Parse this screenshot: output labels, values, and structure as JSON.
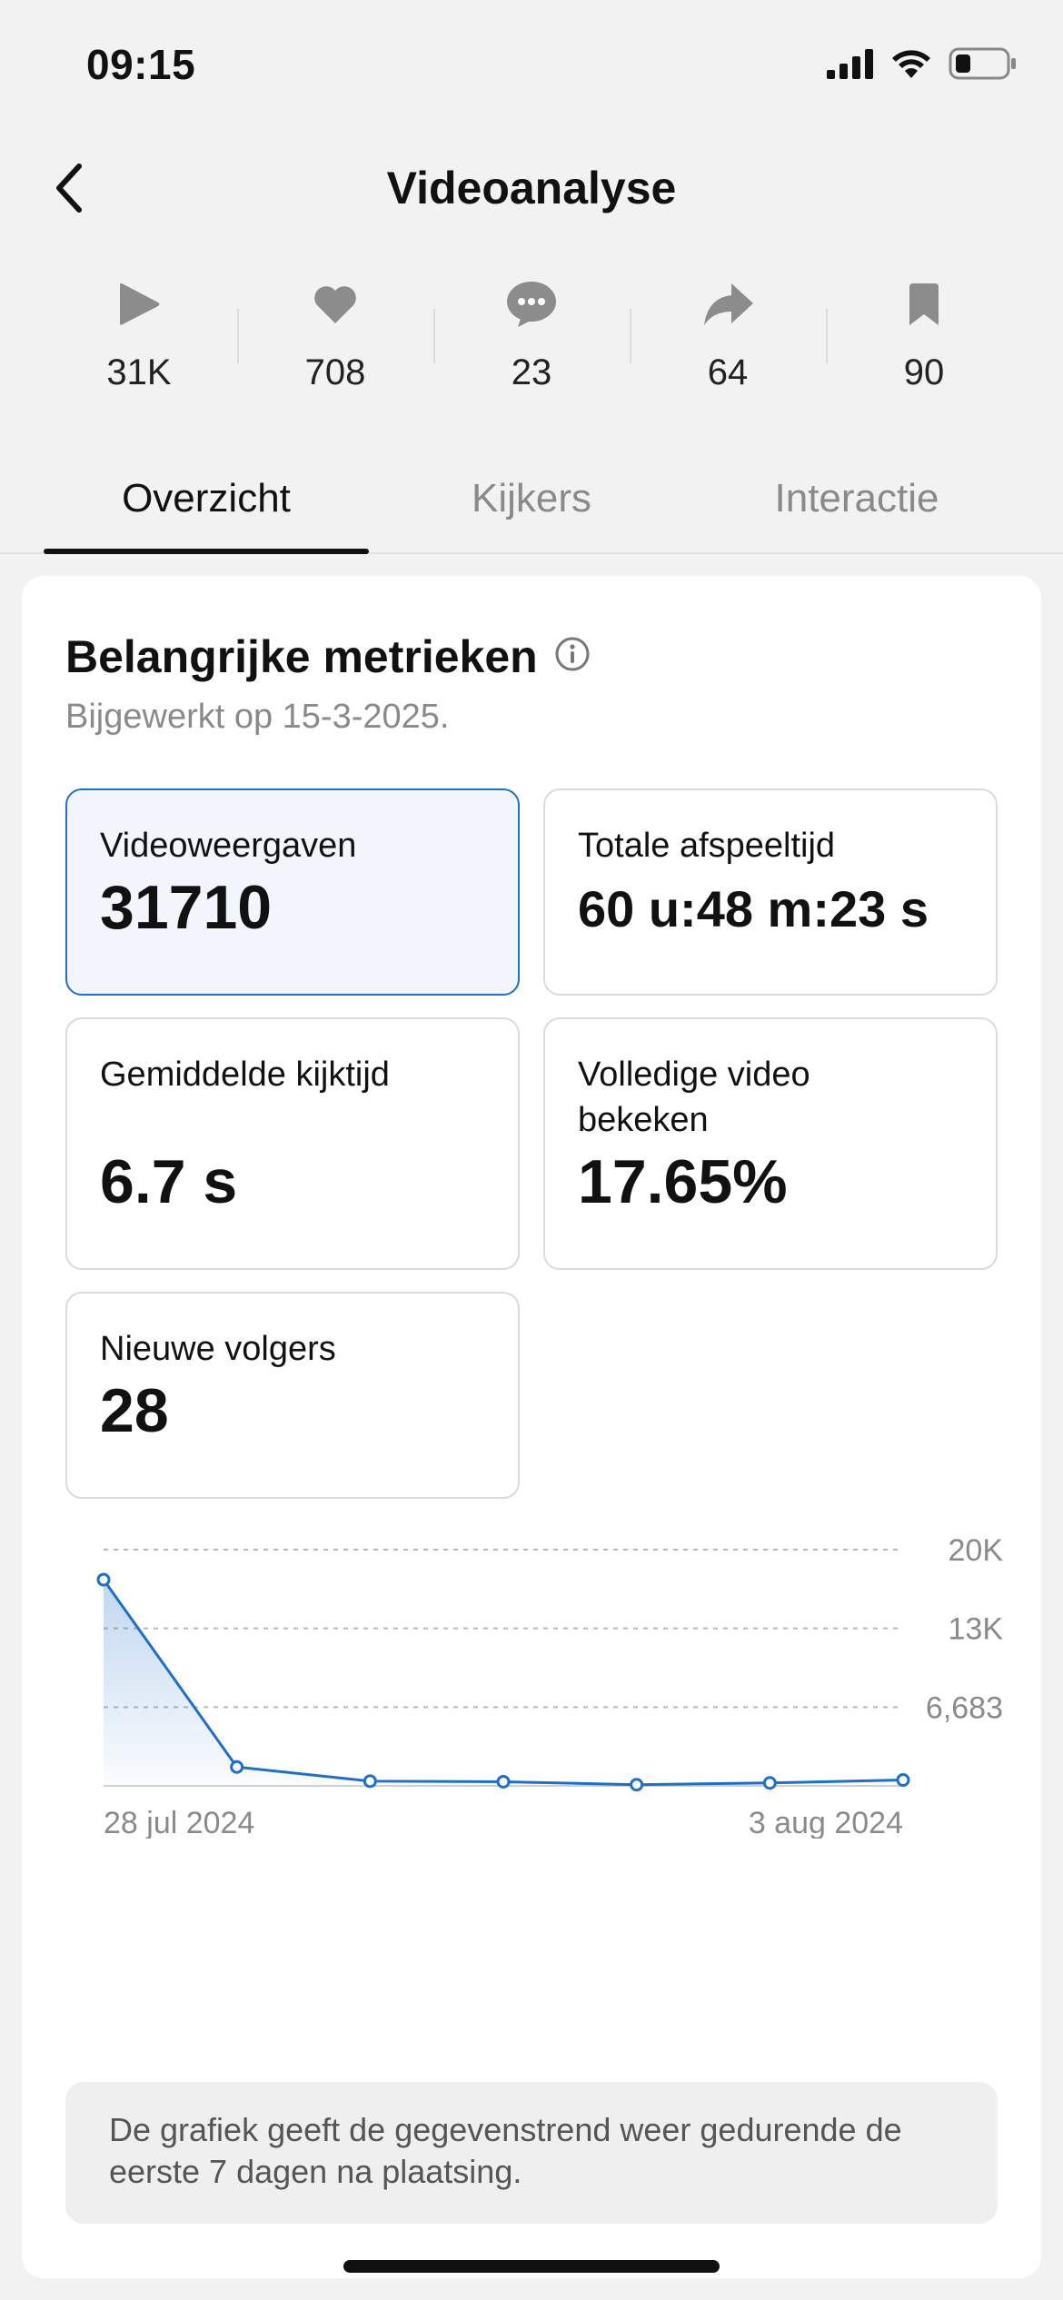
{
  "status_bar": {
    "time": "09:15"
  },
  "header": {
    "title": "Videoanalyse"
  },
  "stats": [
    {
      "icon": "play-icon",
      "value": "31K"
    },
    {
      "icon": "heart-icon",
      "value": "708"
    },
    {
      "icon": "comment-icon",
      "value": "23"
    },
    {
      "icon": "share-icon",
      "value": "64"
    },
    {
      "icon": "bookmark-icon",
      "value": "90"
    }
  ],
  "tabs": [
    {
      "label": "Overzicht",
      "active": true
    },
    {
      "label": "Kijkers",
      "active": false
    },
    {
      "label": "Interactie",
      "active": false
    }
  ],
  "card": {
    "title": "Belangrijke metrieken",
    "updated": "Bijgewerkt op 15-3-2025.",
    "metrics": [
      {
        "label": "Videoweergaven",
        "value": "31710"
      },
      {
        "label": "Totale afspeeltijd",
        "value": "60 u:48 m:23 s"
      },
      {
        "label": "Gemiddelde kijktijd",
        "value": "6.7 s"
      },
      {
        "label": "Volledige video bekeken",
        "value": "17.65%"
      },
      {
        "label": "Nieuwe volgers",
        "value": "28"
      }
    ],
    "note": "De grafiek geeft de gegevenstrend weer gedurende de eerste 7 dagen na plaatsing."
  },
  "chart_data": {
    "type": "area",
    "x": [
      "28 jul 2024",
      "29 jul 2024",
      "30 jul 2024",
      "31 jul 2024",
      "1 aug 2024",
      "2 aug 2024",
      "3 aug 2024"
    ],
    "x_tick_labels": [
      "28 jul 2024",
      "3 aug 2024"
    ],
    "y_tick_labels": [
      "20K",
      "13K",
      "6,683"
    ],
    "y_ticks": [
      20049,
      13366,
      6683
    ],
    "ylim": [
      0,
      20049
    ],
    "values": [
      17500,
      1600,
      400,
      350,
      100,
      250,
      500
    ],
    "color": "#1f6fc7",
    "grid": true
  },
  "colors": {
    "accent": "#1f6fc7",
    "active_bg": "#f2f6fc"
  }
}
